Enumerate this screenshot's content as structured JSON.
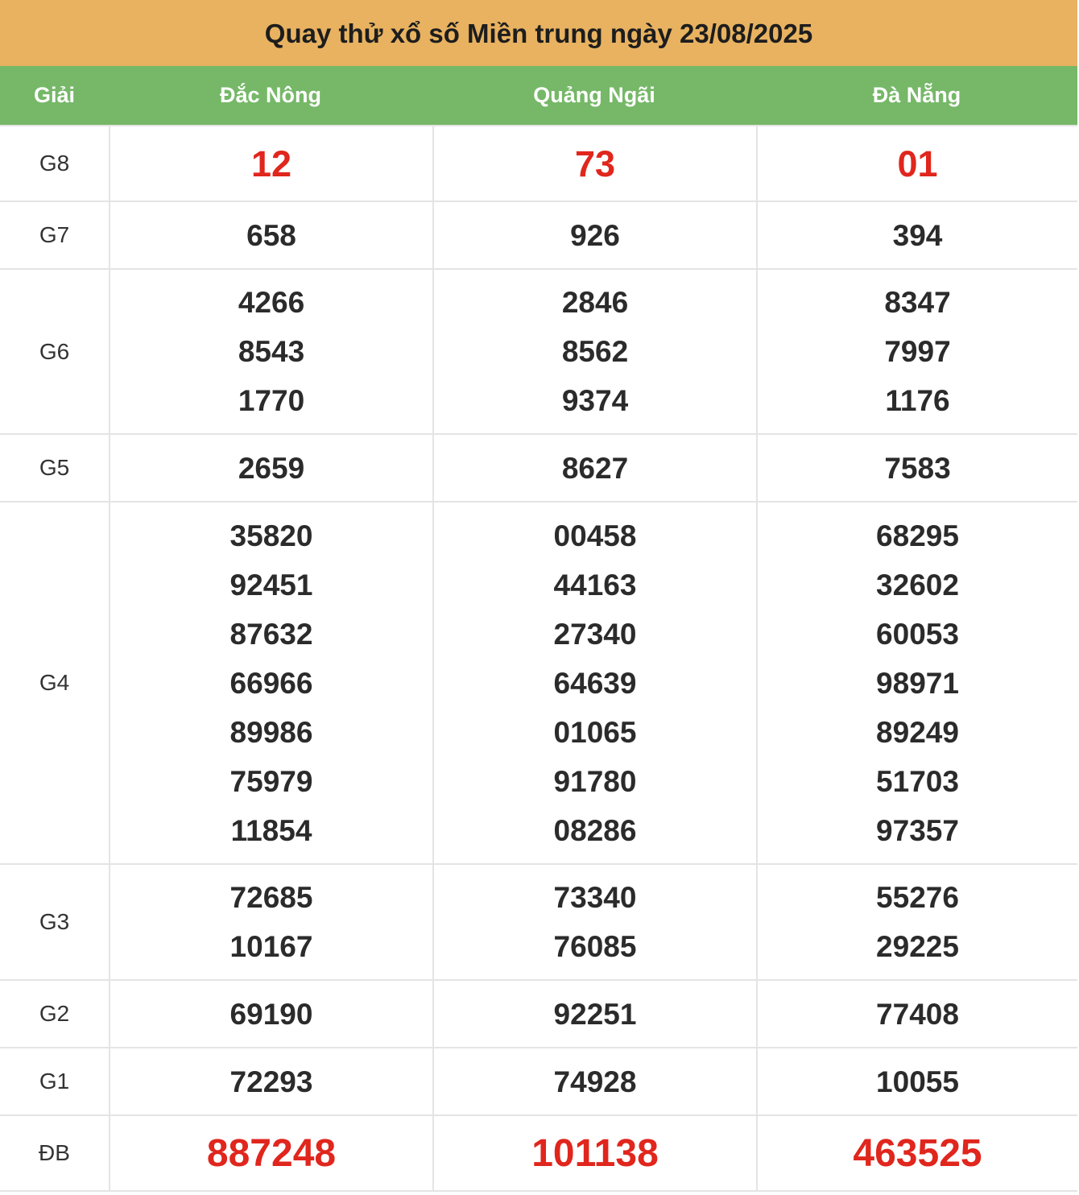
{
  "title": "Quay thử xổ số Miền trung ngày 23/08/2025",
  "header": {
    "prize": "Giải",
    "provinces": [
      "Đắc Nông",
      "Quảng Ngãi",
      "Đà Nẵng"
    ]
  },
  "colors": {
    "title_bg": "#e8b261",
    "header_bg": "#76b868",
    "highlight": "#e0261d"
  },
  "rows": [
    {
      "label": "G8",
      "style": "red",
      "cols": [
        [
          "12"
        ],
        [
          "73"
        ],
        [
          "01"
        ]
      ]
    },
    {
      "label": "G7",
      "style": "normal",
      "cols": [
        [
          "658"
        ],
        [
          "926"
        ],
        [
          "394"
        ]
      ]
    },
    {
      "label": "G6",
      "style": "normal",
      "cols": [
        [
          "4266",
          "8543",
          "1770"
        ],
        [
          "2846",
          "8562",
          "9374"
        ],
        [
          "8347",
          "7997",
          "1176"
        ]
      ]
    },
    {
      "label": "G5",
      "style": "normal",
      "cols": [
        [
          "2659"
        ],
        [
          "8627"
        ],
        [
          "7583"
        ]
      ]
    },
    {
      "label": "G4",
      "style": "normal",
      "cols": [
        [
          "35820",
          "92451",
          "87632",
          "66966",
          "89986",
          "75979",
          "11854"
        ],
        [
          "00458",
          "44163",
          "27340",
          "64639",
          "01065",
          "91780",
          "08286"
        ],
        [
          "68295",
          "32602",
          "60053",
          "98971",
          "89249",
          "51703",
          "97357"
        ]
      ]
    },
    {
      "label": "G3",
      "style": "normal",
      "cols": [
        [
          "72685",
          "10167"
        ],
        [
          "73340",
          "76085"
        ],
        [
          "55276",
          "29225"
        ]
      ]
    },
    {
      "label": "G2",
      "style": "normal",
      "cols": [
        [
          "69190"
        ],
        [
          "92251"
        ],
        [
          "77408"
        ]
      ]
    },
    {
      "label": "G1",
      "style": "normal",
      "cols": [
        [
          "72293"
        ],
        [
          "74928"
        ],
        [
          "10055"
        ]
      ]
    },
    {
      "label": "ĐB",
      "style": "special",
      "cols": [
        [
          "887248"
        ],
        [
          "101138"
        ],
        [
          "463525"
        ]
      ]
    }
  ]
}
